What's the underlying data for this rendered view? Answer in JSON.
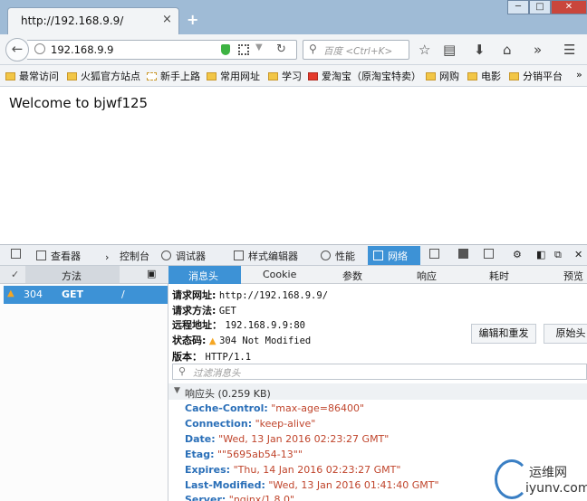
{
  "window": {
    "min": "─",
    "max": "□",
    "close": "✕"
  },
  "tab": {
    "title": "http://192.168.9.9/",
    "close": "×",
    "new_tab": "+"
  },
  "nav": {
    "back": "←",
    "url": "192.168.9.9",
    "reload": "↻",
    "search_placeholder": "百度 <Ctrl+K>",
    "more": "»",
    "menu": "☰"
  },
  "bookmarks": [
    {
      "label": "最常访问"
    },
    {
      "label": "火狐官方站点"
    },
    {
      "label": "新手上路"
    },
    {
      "label": "常用网址"
    },
    {
      "label": "学习"
    },
    {
      "label": "爱淘宝（原淘宝特卖）"
    },
    {
      "label": "网购"
    },
    {
      "label": "电影"
    },
    {
      "label": "分销平台"
    },
    {
      "label": "»"
    }
  ],
  "page": {
    "welcome": "Welcome to bjwf125"
  },
  "devtools": {
    "tools": [
      "查看器",
      "控制台",
      "调试器",
      "样式编辑器",
      "性能",
      "网络"
    ],
    "close": "✕"
  },
  "requests": {
    "headers": {
      "check": "✓",
      "method": "方法"
    },
    "row": {
      "status": "304",
      "method": "GET",
      "file": "/"
    }
  },
  "detail_tabs": [
    "消息头",
    "Cookie",
    "参数",
    "响应",
    "耗时",
    "预览"
  ],
  "summary": {
    "url_label": "请求网址:",
    "url": "http://192.168.9.9/",
    "method_label": "请求方法:",
    "method": "GET",
    "remote_label": "远程地址：",
    "remote": "192.168.9.9:80",
    "status_label": "状态码:",
    "status": "304 Not Modified",
    "version_label": "版本：",
    "version": "HTTP/1.1",
    "edit_resend": "编辑和重发",
    "raw_headers": "原始头"
  },
  "filter_placeholder": "过滤消息头",
  "response_headers": {
    "title": "响应头 (0.259 KB)",
    "items": [
      {
        "key": "Cache-Control:",
        "value": "\"max-age=86400\""
      },
      {
        "key": "Connection:",
        "value": "\"keep-alive\""
      },
      {
        "key": "Date:",
        "value": "\"Wed, 13 Jan 2016 02:23:27 GMT\""
      },
      {
        "key": "Etag:",
        "value": "\"\"5695ab54-13\"\""
      },
      {
        "key": "Expires:",
        "value": "\"Thu, 14 Jan 2016 02:23:27 GMT\""
      },
      {
        "key": "Last-Modified:",
        "value": "\"Wed, 13 Jan 2016 01:41:40 GMT\""
      },
      {
        "key": "Server:",
        "value": "\"nginx/1.8.0\""
      }
    ]
  },
  "watermark": {
    "cn": "运维网",
    "en": "iyunv.com"
  },
  "colors": {
    "accent": "#3d92d6",
    "header_key": "#2a6fb8",
    "header_value": "#c0452c"
  }
}
